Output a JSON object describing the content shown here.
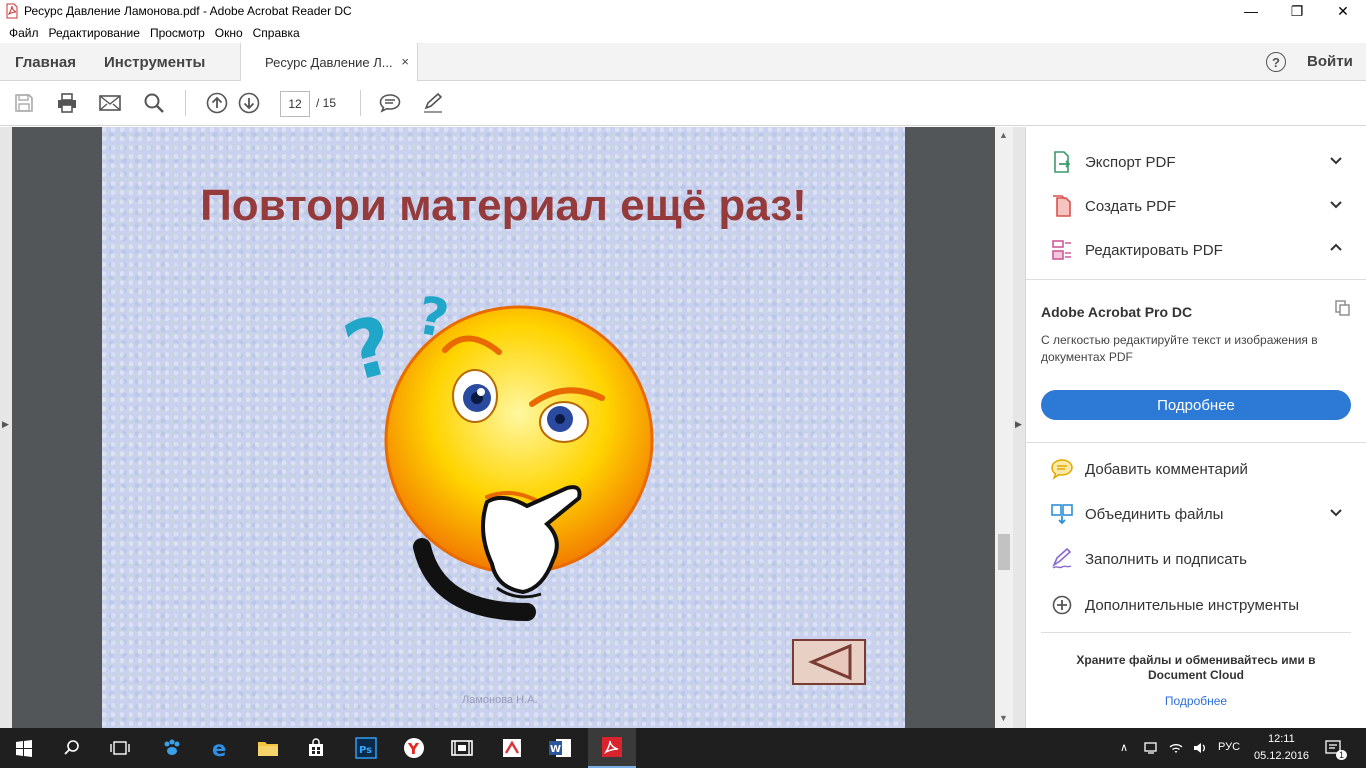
{
  "window": {
    "title": "Ресурс Давление Ламонова.pdf - Adobe Acrobat Reader DC",
    "minimize": "—",
    "maximize": "❐",
    "close": "✕"
  },
  "menu": [
    "Файл",
    "Редактирование",
    "Просмотр",
    "Окно",
    "Справка"
  ],
  "nav": {
    "home": "Главная",
    "tools": "Инструменты",
    "doc_tab": "Ресурс Давление Л...",
    "doc_tab_close": "×",
    "help": "?",
    "signin": "Войти"
  },
  "toolbar": {
    "page_current": "12",
    "page_total": "/  15"
  },
  "slide": {
    "title": "Повтори материал ещё раз!",
    "author": "Ламонова Н.А."
  },
  "panel": {
    "tools_top": [
      {
        "label": "Экспорт PDF",
        "icon": "export-pdf-icon",
        "expanded": false
      },
      {
        "label": "Создать PDF",
        "icon": "create-pdf-icon",
        "expanded": false
      },
      {
        "label": "Редактировать PDF",
        "icon": "edit-pdf-icon",
        "expanded": true
      }
    ],
    "promo": {
      "title": "Adobe Acrobat Pro DC",
      "text": "С легкостью редактируйте текст и изображения в документах PDF",
      "button": "Подробнее"
    },
    "tools_bottom": [
      {
        "label": "Добавить комментарий",
        "icon": "comment-icon"
      },
      {
        "label": "Объединить файлы",
        "icon": "combine-files-icon"
      },
      {
        "label": "Заполнить и подписать",
        "icon": "fill-sign-icon"
      },
      {
        "label": "Дополнительные инструменты",
        "icon": "more-tools-icon"
      }
    ],
    "cloud_text": "Храните файлы и обменивайтесь ими в Document Cloud",
    "cloud_link": "Подробнее"
  },
  "taskbar": {
    "language": "РУС",
    "time": "12:11",
    "date": "05.12.2016",
    "notifications": "1"
  },
  "colors": {
    "accent": "#2d7ad6",
    "slide_title": "#953b3b",
    "taskbar": "#1f1f1f"
  }
}
